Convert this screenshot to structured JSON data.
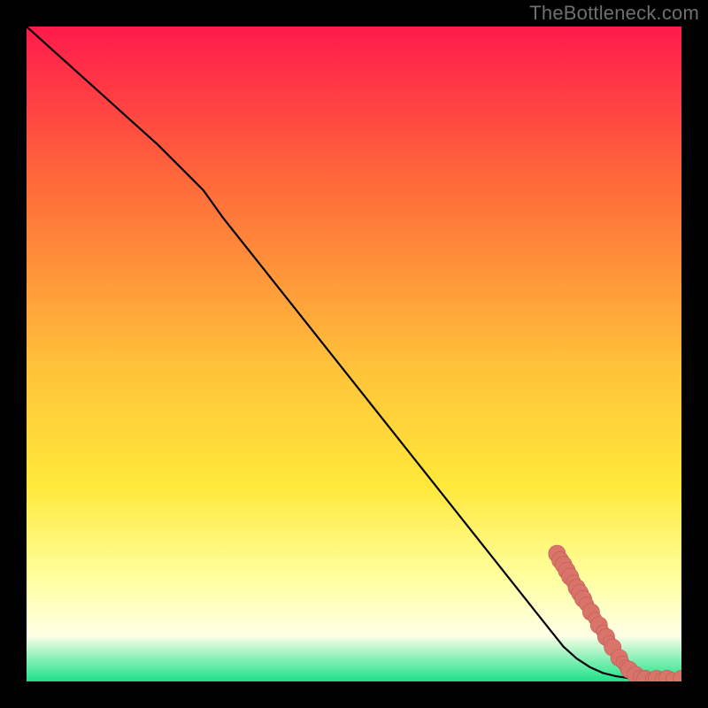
{
  "watermark": "TheBottleneck.com",
  "colors": {
    "frame": "#000000",
    "watermark": "#6f6f6f",
    "gradient_top": "#ff1a4b",
    "gradient_mid_upper": "#ff6a3a",
    "gradient_mid": "#ffc23a",
    "gradient_mid_lower": "#ffe83a",
    "gradient_yellow_pale": "#ffff9e",
    "gradient_green": "#1fe08a",
    "curve": "#000000",
    "marker_fill": "#d9746b",
    "marker_stroke": "#c05a52"
  },
  "chart_data": {
    "type": "line",
    "title": "",
    "xlabel": "",
    "ylabel": "",
    "xlim": [
      0,
      100
    ],
    "ylim": [
      0,
      100
    ],
    "grid": false,
    "axes_visible": false,
    "series": [
      {
        "name": "curve",
        "x": [
          0,
          5,
          10,
          15,
          20,
          25,
          27,
          30,
          35,
          40,
          45,
          50,
          55,
          60,
          65,
          70,
          75,
          80,
          82,
          84,
          86,
          88,
          90,
          92,
          94,
          96,
          98,
          100
        ],
        "y": [
          100,
          95.5,
          91,
          86.5,
          82,
          77,
          75,
          70.8,
          64.5,
          58.2,
          51.9,
          45.6,
          39.3,
          33.0,
          26.7,
          20.4,
          14.1,
          7.8,
          5.3,
          3.5,
          2.2,
          1.3,
          0.8,
          0.5,
          0.3,
          0.2,
          0.15,
          0.1
        ]
      }
    ],
    "markers": [
      {
        "x": 81.0,
        "y": 19.5,
        "r": 1.3
      },
      {
        "x": 81.5,
        "y": 18.5,
        "r": 1.3
      },
      {
        "x": 82.0,
        "y": 17.8,
        "r": 1.3
      },
      {
        "x": 82.5,
        "y": 16.9,
        "r": 1.3
      },
      {
        "x": 83.0,
        "y": 16.0,
        "r": 1.3
      },
      {
        "x": 83.5,
        "y": 15.2,
        "r": 1.1
      },
      {
        "x": 84.0,
        "y": 14.3,
        "r": 1.3
      },
      {
        "x": 84.5,
        "y": 13.5,
        "r": 1.3
      },
      {
        "x": 85.0,
        "y": 12.6,
        "r": 1.3
      },
      {
        "x": 85.5,
        "y": 11.8,
        "r": 1.1
      },
      {
        "x": 86.2,
        "y": 10.6,
        "r": 1.3
      },
      {
        "x": 86.8,
        "y": 9.6,
        "r": 1.0
      },
      {
        "x": 87.4,
        "y": 8.6,
        "r": 1.3
      },
      {
        "x": 88.0,
        "y": 7.6,
        "r": 1.0
      },
      {
        "x": 88.5,
        "y": 6.8,
        "r": 1.3
      },
      {
        "x": 89.0,
        "y": 6.0,
        "r": 1.0
      },
      {
        "x": 89.5,
        "y": 5.2,
        "r": 1.3
      },
      {
        "x": 90.5,
        "y": 3.6,
        "r": 1.3
      },
      {
        "x": 91.0,
        "y": 2.9,
        "r": 1.0
      },
      {
        "x": 91.5,
        "y": 2.3,
        "r": 1.0
      },
      {
        "x": 92.0,
        "y": 1.8,
        "r": 1.3
      },
      {
        "x": 93.0,
        "y": 1.0,
        "r": 1.3
      },
      {
        "x": 93.6,
        "y": 0.65,
        "r": 1.0
      },
      {
        "x": 94.5,
        "y": 0.4,
        "r": 1.3
      },
      {
        "x": 95.5,
        "y": 0.4,
        "r": 1.0
      },
      {
        "x": 96.2,
        "y": 0.4,
        "r": 1.3
      },
      {
        "x": 97.0,
        "y": 0.4,
        "r": 1.0
      },
      {
        "x": 97.8,
        "y": 0.4,
        "r": 1.3
      },
      {
        "x": 98.6,
        "y": 0.4,
        "r": 1.0
      },
      {
        "x": 100.0,
        "y": 0.4,
        "r": 1.3
      }
    ]
  }
}
